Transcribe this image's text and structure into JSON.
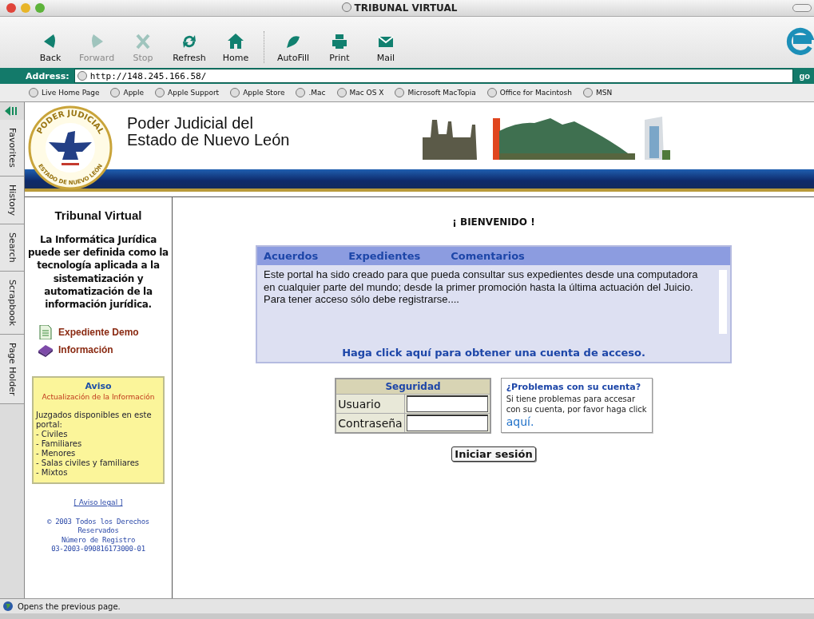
{
  "window": {
    "title": "TRIBUNAL VIRTUAL"
  },
  "toolbar": [
    {
      "label": "Back",
      "kind": "back",
      "disabled": false
    },
    {
      "label": "Forward",
      "kind": "forward",
      "disabled": true
    },
    {
      "label": "Stop",
      "kind": "stop",
      "disabled": true
    },
    {
      "label": "Refresh",
      "kind": "refresh",
      "disabled": false
    },
    {
      "label": "Home",
      "kind": "home",
      "disabled": false
    },
    {
      "label": "AutoFill",
      "kind": "autofill",
      "disabled": false
    },
    {
      "label": "Print",
      "kind": "print",
      "disabled": false
    },
    {
      "label": "Mail",
      "kind": "mail",
      "disabled": false
    }
  ],
  "address": {
    "label": "Address:",
    "url": "http://148.245.166.58/",
    "go": "go"
  },
  "favorites": [
    "Live Home Page",
    "Apple",
    "Apple Support",
    "Apple Store",
    ".Mac",
    "Mac OS X",
    "Microsoft MacTopia",
    "Office for Macintosh",
    "MSN"
  ],
  "explorer_tabs": [
    "Favorites",
    "History",
    "Search",
    "Scrapbook",
    "Page Holder"
  ],
  "header": {
    "seal_top": "PODER JUDICIAL",
    "seal_bottom": "ESTADO DE NUEVO LEÓN",
    "title_lines": [
      "Poder Judicial del",
      "Estado de Nuevo León"
    ]
  },
  "sidebar": {
    "title": "Tribunal Virtual",
    "intro": "La Informática Jurídica puede ser definida como la tecnología aplicada a la sistematización y automatización de la información jurídica.",
    "links": [
      {
        "label": "Expediente Demo",
        "kind": "document"
      },
      {
        "label": "Información",
        "kind": "book"
      }
    ],
    "aviso": {
      "title": "Aviso",
      "subtitle": "Actualización de la Información",
      "intro": "Juzgados disponibles en este portal:",
      "items": [
        "- Civiles",
        "- Familiares",
        "- Menores",
        "- Salas civiles y familiares",
        "- Mixtos"
      ]
    },
    "legal": "[ Aviso legal ]",
    "copyright": "© 2003 Todos los Derechos Reservados",
    "registro": "Número de Registro",
    "registro_numero": "03-2003-090816173000-01"
  },
  "main": {
    "welcome": "¡ BIENVENIDO !",
    "tabs": [
      "Acuerdos",
      "Expedientes",
      "Comentarios"
    ],
    "text": "Este portal ha sido creado para que pueda consultar sus expedientes desde una computadora en cualquier parte del mundo; desde la primer promoción hasta la última actuación del Juicio. Para tener acceso sólo debe registrarse....",
    "signup": "Haga click aquí para obtener una cuenta de acceso.",
    "login": {
      "title": "Seguridad",
      "fields": [
        {
          "label": "Usuario"
        },
        {
          "label": "Contraseña"
        }
      ],
      "button": "Iniciar sesión"
    },
    "help": {
      "title": "¿Problemas con su cuenta?",
      "text": "Si tiene problemas para accesar con su cuenta, por favor haga click",
      "link": "aquí."
    }
  },
  "status_bar": "Opens the previous page."
}
